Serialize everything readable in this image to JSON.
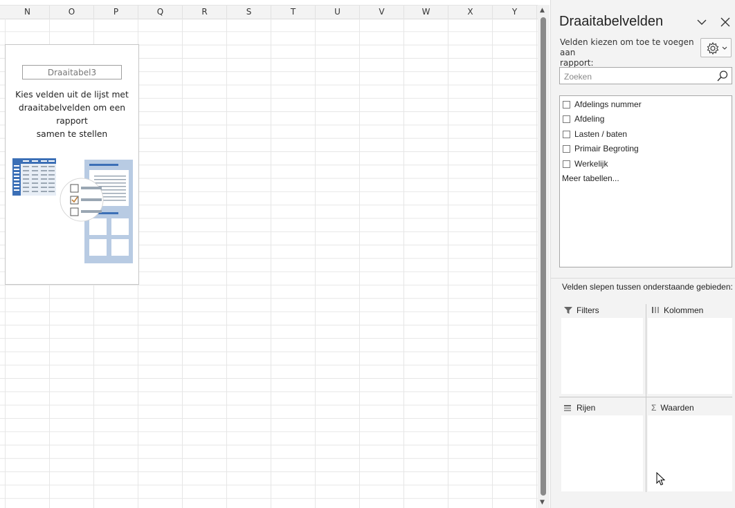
{
  "grid": {
    "columns": [
      "N",
      "O",
      "P",
      "Q",
      "R",
      "S",
      "T",
      "U",
      "V",
      "W",
      "X",
      "Y"
    ]
  },
  "pivot_placeholder": {
    "name": "Draaitabel3",
    "instruction_line1": "Kies velden uit de lijst met",
    "instruction_line2": "draaitabelvelden om een rapport",
    "instruction_line3": "samen te stellen"
  },
  "pane": {
    "title": "Draaitabelvelden",
    "subtitle_line1": "Velden kiezen om toe te voegen aan",
    "subtitle_line2": "rapport:",
    "search_placeholder": "Zoeken",
    "fields": [
      {
        "label": "Afdelings nummer",
        "checked": false
      },
      {
        "label": "Afdeling",
        "checked": false
      },
      {
        "label": "Lasten / baten",
        "checked": false
      },
      {
        "label": "Primair Begroting",
        "checked": false
      },
      {
        "label": "Werkelijk",
        "checked": false
      }
    ],
    "more_tables": "Meer tabellen...",
    "drag_label": "Velden slepen tussen onderstaande gebieden:",
    "areas": {
      "filters": "Filters",
      "columns": "Kolommen",
      "rows": "Rijen",
      "values": "Waarden"
    },
    "icons": {
      "collapse": "chevron-down-icon",
      "close": "close-icon",
      "gear": "gear-icon",
      "search": "search-icon"
    }
  },
  "colors": {
    "accent_blue": "#3b6fb6",
    "illustration_blue": "#b8cbe3"
  }
}
